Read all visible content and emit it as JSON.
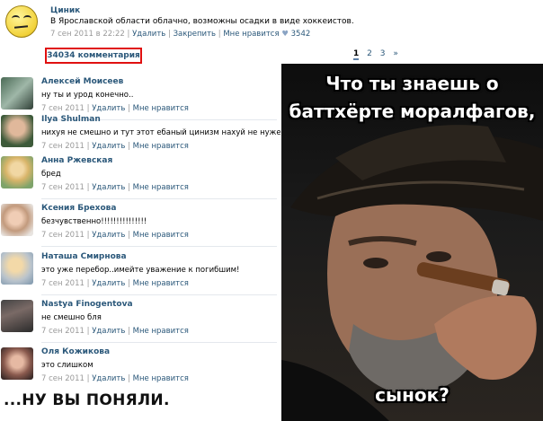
{
  "post": {
    "author": "Циник",
    "text": "В Ярославской области облачно, возможны осадки в виде хоккеистов.",
    "date": "7 сен 2011 в 22:22",
    "delete": "Удалить",
    "pin": "Закрепить",
    "like": "Мне нравится",
    "like_count": "3542"
  },
  "comments_counter": "34034 комментария",
  "pager": [
    "1",
    "2",
    "3",
    "»"
  ],
  "comments": [
    {
      "name": "Алексей Моисеев",
      "text": "ну ты и урод конечно..",
      "date": "7 сен 2011",
      "delete": "Удалить",
      "like": "Мне нравится"
    },
    {
      "name": "Ilya Shulman",
      "text": "нихуя не смешно и тут этот ебаный цинизм нахуй не нужен!",
      "date": "7 сен 2011",
      "delete": "Удалить",
      "like": "Мне нравится"
    },
    {
      "name": "Анна Ржевская",
      "text": "бред",
      "date": "7 сен 2011",
      "delete": "Удалить",
      "like": "Мне нравится"
    },
    {
      "name": "Ксения Брехова",
      "text": "безчувственно!!!!!!!!!!!!!!!",
      "date": "7 сен 2011",
      "delete": "Удалить",
      "like": "Мне нравится"
    },
    {
      "name": "Наташа Смирнова",
      "text": "это уже перебор..имейте уважение к погибшим!",
      "date": "7 сен 2011",
      "delete": "Удалить",
      "like": "Мне нравится"
    },
    {
      "name": "Nastya Finogentova",
      "text": "не смешно бля",
      "date": "7 сен 2011",
      "delete": "Удалить",
      "like": "Мне нравится"
    },
    {
      "name": "Оля Кожикова",
      "text": "это слишком",
      "date": "7 сен 2011",
      "delete": "Удалить",
      "like": "Мне нравится"
    }
  ],
  "caption_left": "...НУ ВЫ ПОНЯЛИ.",
  "meme": {
    "top_text_1": "Что ты знаешь о",
    "top_text_2": "баттхёрте моралфагов,",
    "bottom_text": "сынок?"
  }
}
